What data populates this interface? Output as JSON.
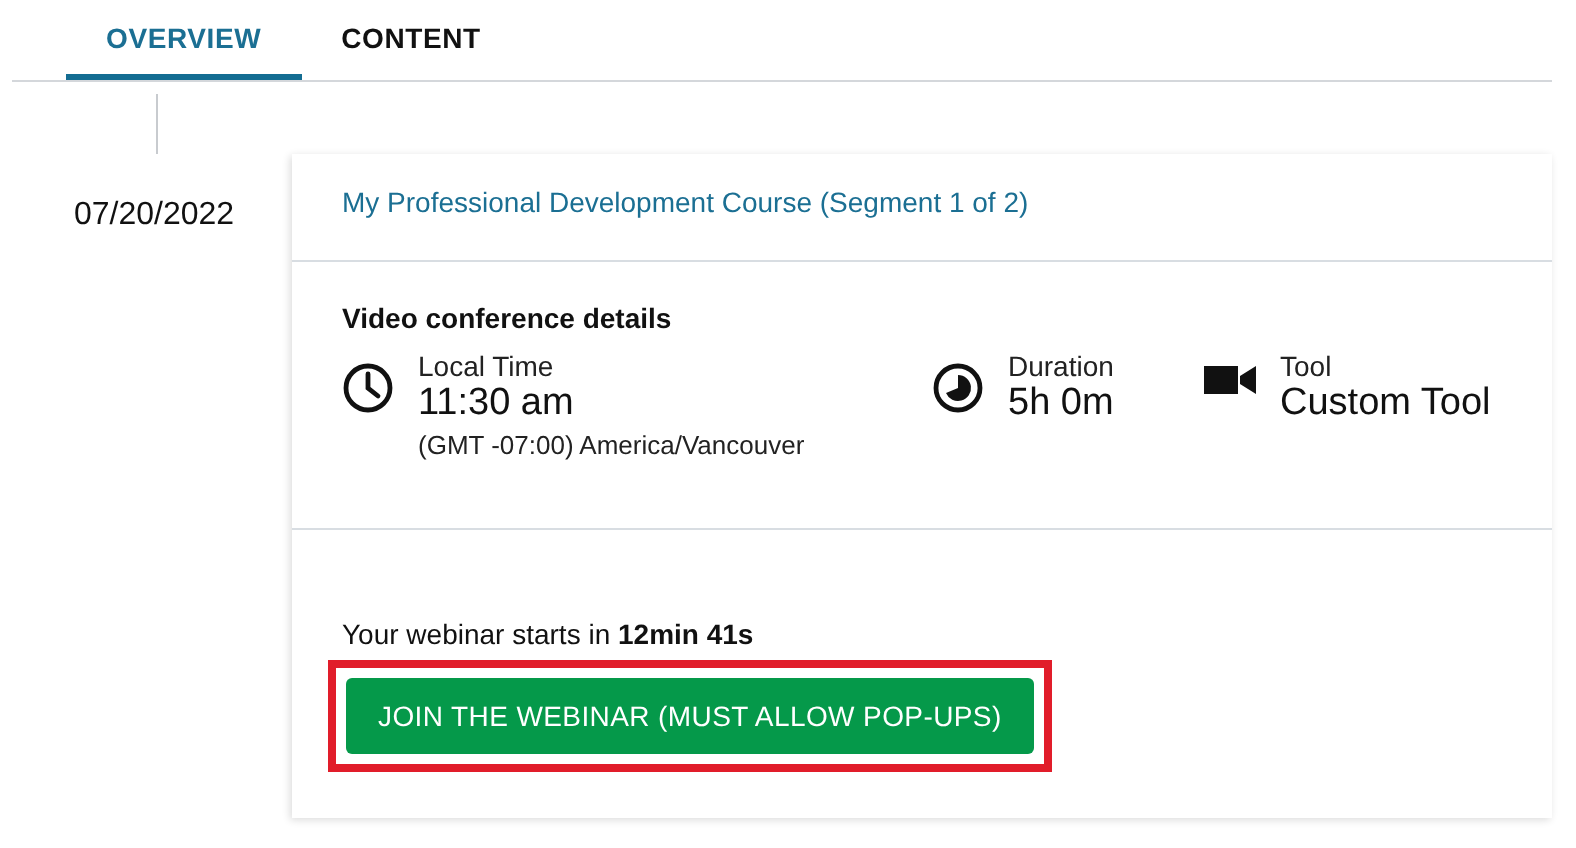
{
  "tabs": [
    {
      "label": "OVERVIEW",
      "selected": true
    },
    {
      "label": "CONTENT",
      "selected": false
    }
  ],
  "session": {
    "date": "07/20/2022",
    "title": "My Professional Development Course (Segment 1 of 2)",
    "details_heading": "Video conference details",
    "details": [
      {
        "kind": "time",
        "label": "Local Time",
        "value": "11:30 am",
        "note": "(GMT -07:00) America/Vancouver"
      },
      {
        "kind": "duration",
        "label": "Duration",
        "value": "5h 0m"
      },
      {
        "kind": "tool",
        "label": "Tool",
        "value": "Custom Tool"
      }
    ],
    "countdown": "Your webinar starts in **12min 41s**",
    "join_button": {
      "label": "JOIN THE WEBINAR (MUST ALLOW POP-UPS)",
      "highlighted": true
    }
  }
}
